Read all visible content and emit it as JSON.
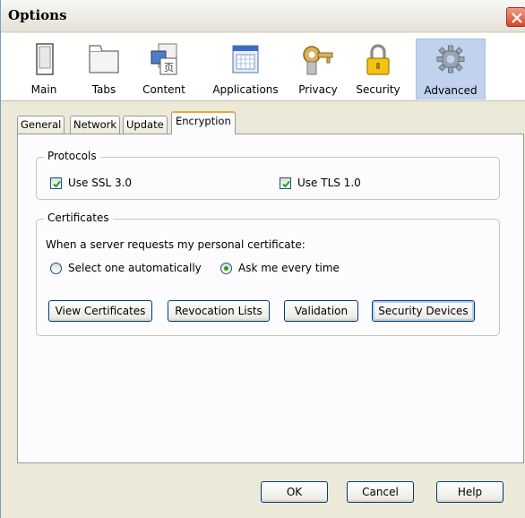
{
  "window": {
    "title": "Options"
  },
  "categories": [
    {
      "label": "Main",
      "icon": "main-icon"
    },
    {
      "label": "Tabs",
      "icon": "tabs-icon"
    },
    {
      "label": "Content",
      "icon": "content-icon"
    },
    {
      "label": "Applications",
      "icon": "applications-icon"
    },
    {
      "label": "Privacy",
      "icon": "privacy-icon"
    },
    {
      "label": "Security",
      "icon": "security-icon"
    },
    {
      "label": "Advanced",
      "icon": "advanced-icon",
      "selected": true
    }
  ],
  "tabs": [
    {
      "label": "General"
    },
    {
      "label": "Network"
    },
    {
      "label": "Update"
    },
    {
      "label": "Encryption",
      "active": true
    }
  ],
  "protocols": {
    "legend": "Protocols",
    "ssl_label": "Use SSL 3.0",
    "ssl_checked": true,
    "tls_label": "Use TLS 1.0",
    "tls_checked": true
  },
  "certificates": {
    "legend": "Certificates",
    "prompt": "When a server requests my personal certificate:",
    "option_auto": "Select one automatically",
    "option_ask": "Ask me every time",
    "selected_option": "Ask me every time",
    "buttons": {
      "view": "View Certificates",
      "revocation": "Revocation Lists",
      "validation": "Validation",
      "devices": "Security Devices"
    }
  },
  "footer": {
    "ok": "OK",
    "cancel": "Cancel",
    "help": "Help"
  },
  "colors": {
    "selected_category": "#c1d2ee",
    "active_tab_accent": "#f3a43b",
    "dialog_bg": "#ece9d8"
  }
}
